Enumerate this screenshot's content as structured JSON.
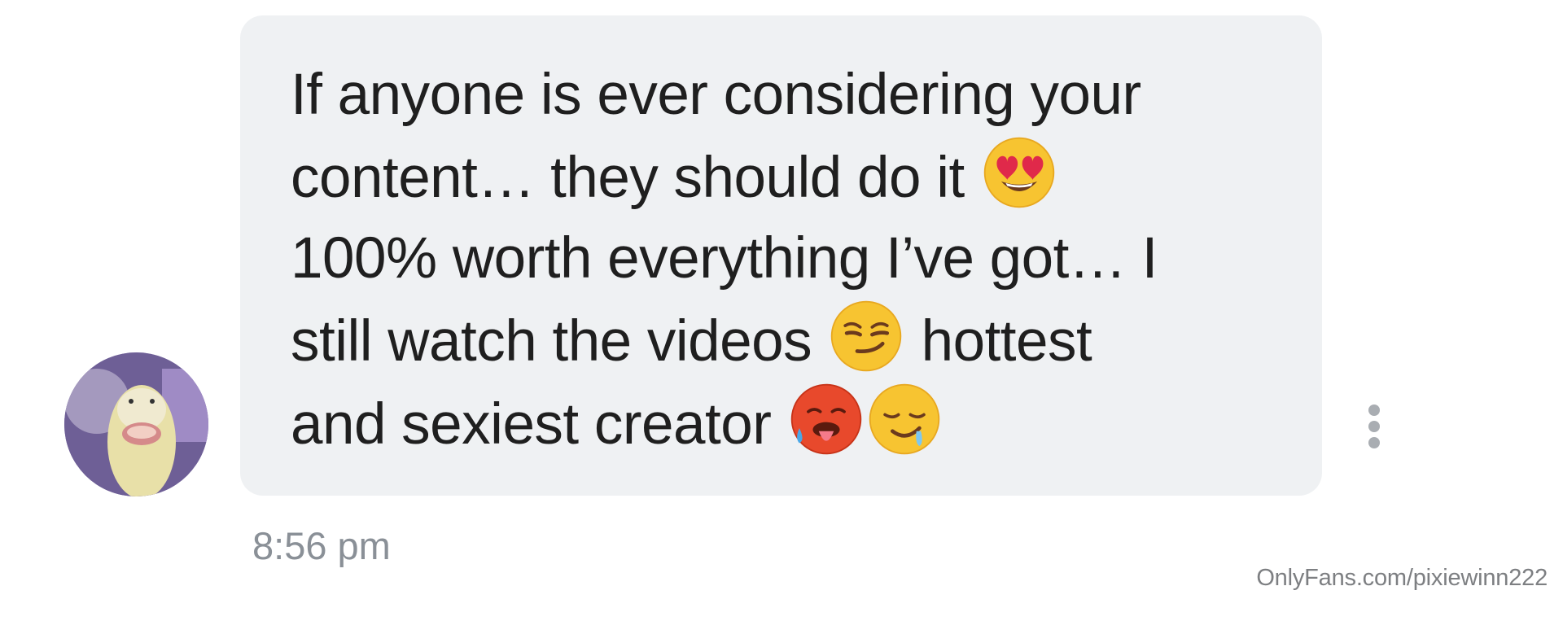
{
  "message": {
    "line1": "If anyone is ever considering your",
    "line2": "content… they should do it",
    "line3": "100% worth everything I’ve got… I",
    "line4a": "still watch the videos",
    "line4b": "hottest",
    "line5": "and sexiest creator",
    "emojis": [
      "smiling-face-with-heart-eyes",
      "smirking-face",
      "hot-face",
      "drooling-face"
    ],
    "timestamp": "8:56 pm"
  },
  "colors": {
    "bubble_bg": "#eff1f3",
    "text": "#1f1f1f",
    "timestamp": "#8a9097",
    "more_dots": "#a9adb2"
  },
  "footer": {
    "watermark": "OnlyFans.com/pixiewinn222"
  }
}
